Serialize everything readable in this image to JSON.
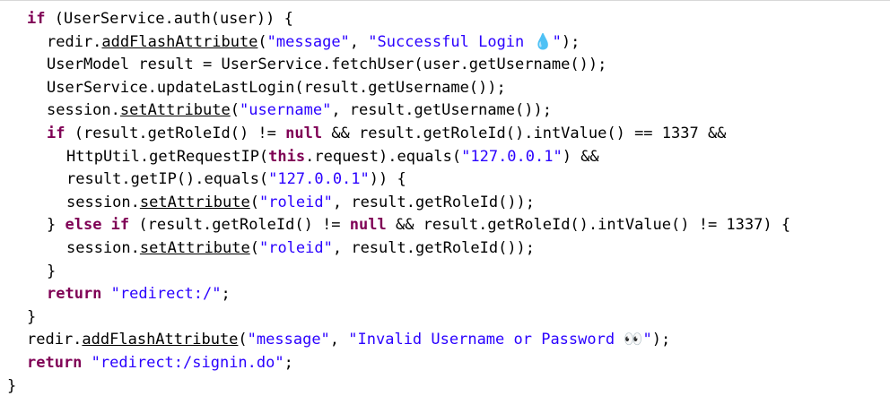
{
  "code": {
    "lines": [
      {
        "indent": 1,
        "tokens": [
          {
            "t": "kw",
            "v": "if"
          },
          {
            "t": "pl",
            "v": " (UserService.auth(user)) {"
          }
        ]
      },
      {
        "indent": 2,
        "tokens": [
          {
            "t": "pl",
            "v": "redir."
          },
          {
            "t": "ul",
            "v": "addFlashAttribute"
          },
          {
            "t": "pl",
            "v": "("
          },
          {
            "t": "str",
            "v": "\"message\""
          },
          {
            "t": "pl",
            "v": ", "
          },
          {
            "t": "str",
            "v": "\"Successful Login 💧\""
          },
          {
            "t": "pl",
            "v": ");"
          }
        ]
      },
      {
        "indent": 2,
        "tokens": [
          {
            "t": "pl",
            "v": "UserModel result = UserService.fetchUser(user.getUsername());"
          }
        ]
      },
      {
        "indent": 2,
        "tokens": [
          {
            "t": "pl",
            "v": "UserService.updateLastLogin(result.getUsername());"
          }
        ]
      },
      {
        "indent": 2,
        "tokens": [
          {
            "t": "pl",
            "v": "session."
          },
          {
            "t": "ul",
            "v": "setAttribute"
          },
          {
            "t": "pl",
            "v": "("
          },
          {
            "t": "str",
            "v": "\"username\""
          },
          {
            "t": "pl",
            "v": ", result.getUsername());"
          }
        ]
      },
      {
        "indent": 2,
        "tokens": [
          {
            "t": "kw",
            "v": "if"
          },
          {
            "t": "pl",
            "v": " (result.getRoleId() != "
          },
          {
            "t": "kw",
            "v": "null"
          },
          {
            "t": "pl",
            "v": " && result.getRoleId().intValue() == 1337 &&"
          }
        ]
      },
      {
        "indent": 3,
        "tokens": [
          {
            "t": "pl",
            "v": "HttpUtil.getRequestIP("
          },
          {
            "t": "kw",
            "v": "this"
          },
          {
            "t": "pl",
            "v": ".request).equals("
          },
          {
            "t": "str",
            "v": "\"127.0.0.1\""
          },
          {
            "t": "pl",
            "v": ") &&"
          }
        ]
      },
      {
        "indent": 3,
        "tokens": [
          {
            "t": "pl",
            "v": "result.getIP().equals("
          },
          {
            "t": "str",
            "v": "\"127.0.0.1\""
          },
          {
            "t": "pl",
            "v": ")) {"
          }
        ]
      },
      {
        "indent": 3,
        "tokens": [
          {
            "t": "pl",
            "v": "session."
          },
          {
            "t": "ul",
            "v": "setAttribute"
          },
          {
            "t": "pl",
            "v": "("
          },
          {
            "t": "str",
            "v": "\"roleid\""
          },
          {
            "t": "pl",
            "v": ", result.getRoleId());"
          }
        ]
      },
      {
        "indent": 2,
        "tokens": [
          {
            "t": "pl",
            "v": "} "
          },
          {
            "t": "kw",
            "v": "else if"
          },
          {
            "t": "pl",
            "v": " (result.getRoleId() != "
          },
          {
            "t": "kw",
            "v": "null"
          },
          {
            "t": "pl",
            "v": " && result.getRoleId().intValue() != 1337) {"
          }
        ]
      },
      {
        "indent": 3,
        "tokens": [
          {
            "t": "pl",
            "v": "session."
          },
          {
            "t": "ul",
            "v": "setAttribute"
          },
          {
            "t": "pl",
            "v": "("
          },
          {
            "t": "str",
            "v": "\"roleid\""
          },
          {
            "t": "pl",
            "v": ", result.getRoleId());"
          }
        ]
      },
      {
        "indent": 2,
        "tokens": [
          {
            "t": "pl",
            "v": "}"
          }
        ]
      },
      {
        "indent": 2,
        "tokens": [
          {
            "t": "kw",
            "v": "return"
          },
          {
            "t": "pl",
            "v": " "
          },
          {
            "t": "str",
            "v": "\"redirect:/\""
          },
          {
            "t": "pl",
            "v": ";"
          }
        ]
      },
      {
        "indent": 1,
        "tokens": [
          {
            "t": "pl",
            "v": "}"
          }
        ]
      },
      {
        "indent": 1,
        "tokens": [
          {
            "t": "pl",
            "v": "redir."
          },
          {
            "t": "ul",
            "v": "addFlashAttribute"
          },
          {
            "t": "pl",
            "v": "("
          },
          {
            "t": "str",
            "v": "\"message\""
          },
          {
            "t": "pl",
            "v": ", "
          },
          {
            "t": "str",
            "v": "\"Invalid Username or Password 👀\""
          },
          {
            "t": "pl",
            "v": ");"
          }
        ]
      },
      {
        "indent": 1,
        "tokens": [
          {
            "t": "kw",
            "v": "return"
          },
          {
            "t": "pl",
            "v": " "
          },
          {
            "t": "str",
            "v": "\"redirect:/signin.do\""
          },
          {
            "t": "pl",
            "v": ";"
          }
        ]
      },
      {
        "indent": 0,
        "tokens": [
          {
            "t": "pl",
            "v": "}"
          }
        ]
      }
    ]
  },
  "colors": {
    "keyword": "#7f0055",
    "string": "#2a00ff",
    "plain": "#000000",
    "background": "#ffffff"
  }
}
